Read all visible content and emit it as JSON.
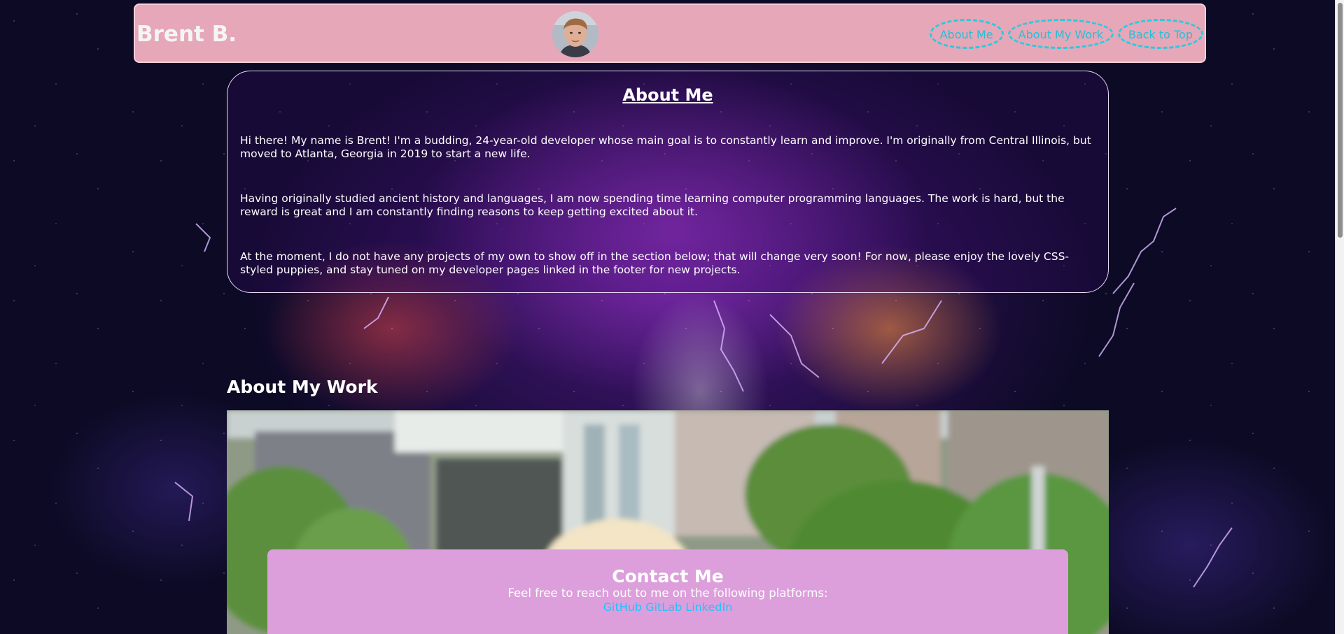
{
  "header": {
    "site_name": "Brent B.",
    "avatar_alt": "Brent B. profile photo",
    "nav": [
      {
        "label": "About Me"
      },
      {
        "label": "About My Work"
      },
      {
        "label": "Back to Top"
      }
    ]
  },
  "about": {
    "title": "About Me",
    "paragraphs": [
      "Hi there! My name is Brent! I'm a budding, 24-year-old developer whose main goal is to constantly learn and improve. I'm originally from Central Illinois, but moved to Atlanta, Georgia in 2019 to start a new life.",
      "Having originally studied ancient history and languages, I am now spending time learning computer programming languages. The work is hard, but the reward is great and I am constantly finding reasons to keep getting excited about it.",
      "At the moment, I do not have any projects of my own to show off in the section below; that will change very soon! For now, please enjoy the lovely CSS-styled puppies, and stay tuned on my developer pages linked in the footer for new projects."
    ]
  },
  "work": {
    "title": "About My Work"
  },
  "contact": {
    "title": "Contact Me",
    "text": "Feel free to reach out to me on the following platforms:",
    "links": [
      {
        "label": "GitHub"
      },
      {
        "label": "GitLab"
      },
      {
        "label": "LinkedIn"
      }
    ]
  },
  "colors": {
    "header_bg": "#efaebf",
    "nav_link": "#21c9e0",
    "contact_bg": "#dc9fdb",
    "contact_link": "#1fc3ff",
    "page_bg": "#0c0a24"
  }
}
